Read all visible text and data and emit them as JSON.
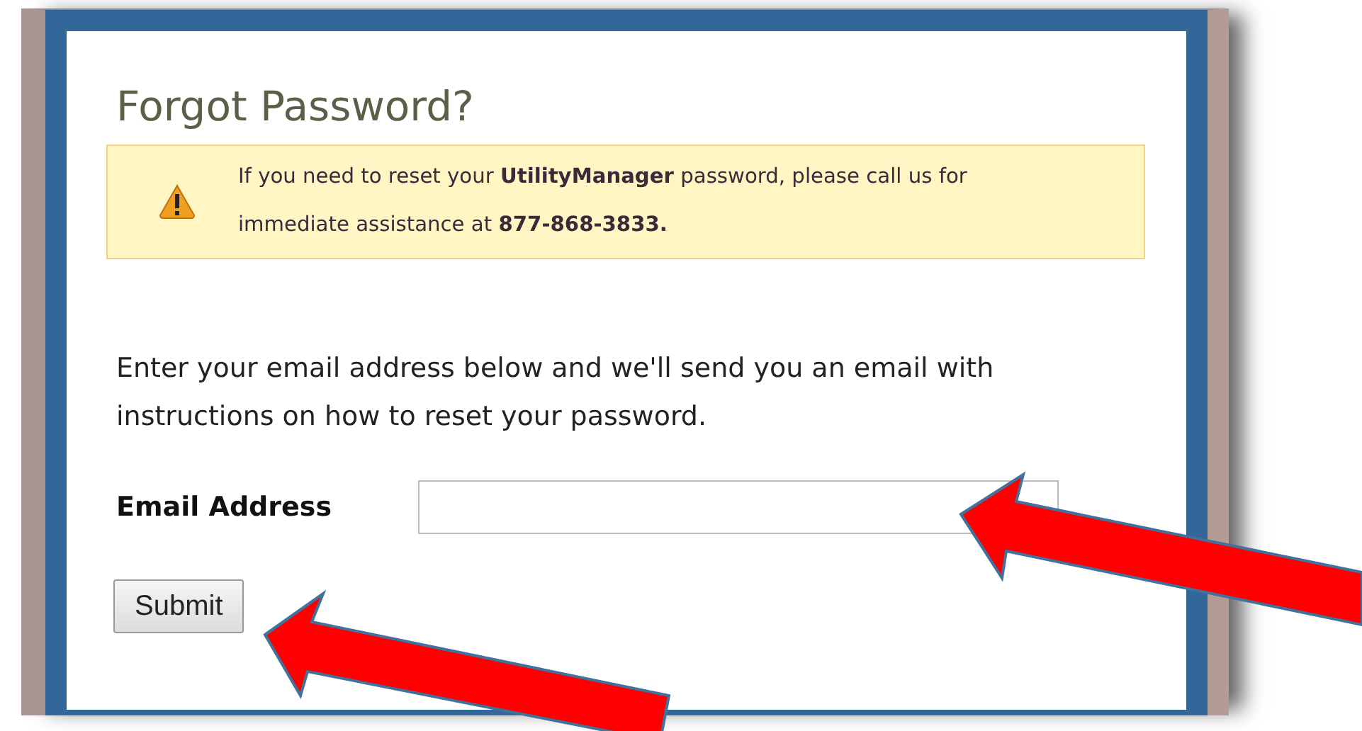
{
  "title": "Forgot Password?",
  "notice": {
    "kind": "warning",
    "text": "If you need to reset your **UtilityManager** password, please call us for immediate assistance at **877-868-3833.**"
  },
  "instructions": "Enter your email address below and we'll send you an email with instructions on how to reset your password.",
  "email_field": {
    "label": "Email Address"
  },
  "buttons": [
    "Submit"
  ]
}
